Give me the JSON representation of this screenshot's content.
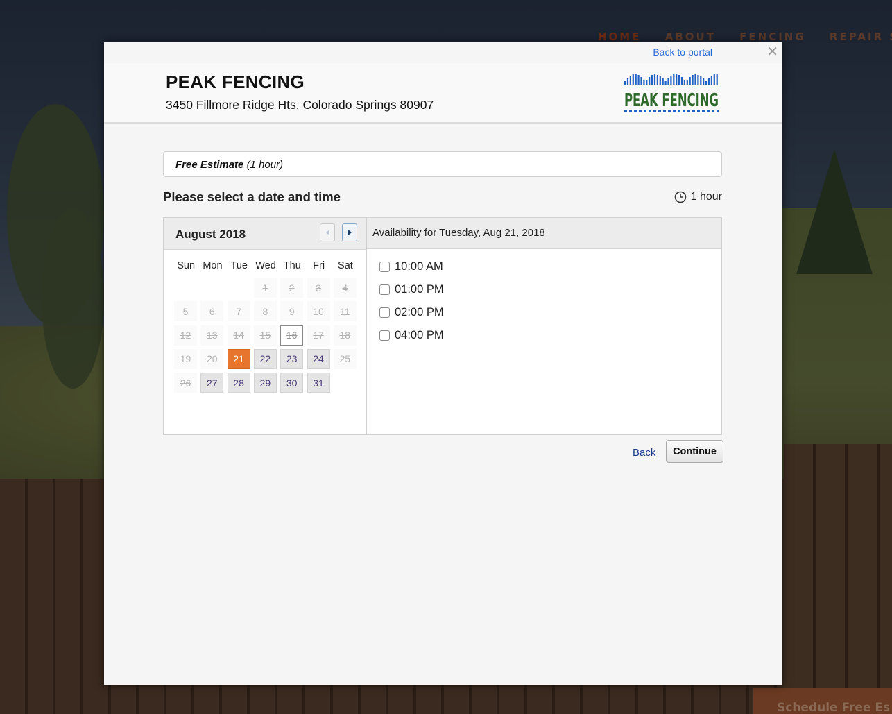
{
  "background": {
    "nav": [
      "HOME",
      "ABOUT",
      "FENCING",
      "REPAIR SERVIC"
    ],
    "cta_label": "Schedule Free Es"
  },
  "modal": {
    "back_to_portal": "Back to portal",
    "close_icon": "close-icon"
  },
  "business": {
    "name": "PEAK FENCING",
    "address": "3450 Fillmore Ridge Hts. Colorado Springs 80907",
    "logo_text": "PEAK FENCING",
    "colors": {
      "logo_blue": "#1e63c4",
      "logo_green": "#2e6b2a"
    }
  },
  "service": {
    "name": "Free Estimate",
    "duration": "(1 hour)"
  },
  "heading": "Please select a date and time",
  "duration_label": "1 hour",
  "calendar": {
    "month": "August 2018",
    "weekdays": [
      "Sun",
      "Mon",
      "Tue",
      "Wed",
      "Thu",
      "Fri",
      "Sat"
    ],
    "first_weekday_index": 3,
    "days_in_month": 31,
    "past_days": [
      1,
      2,
      3,
      4,
      5,
      6,
      7,
      8,
      9,
      10,
      11,
      12,
      13,
      14,
      15,
      16,
      17,
      18,
      19,
      20,
      25,
      26
    ],
    "today": 16,
    "selected": 21,
    "available": [
      22,
      23,
      24,
      27,
      28,
      29,
      30,
      31
    ],
    "colors": {
      "selected": "#e8752e"
    }
  },
  "availability": {
    "title": "Availability for Tuesday, Aug 21, 2018",
    "slots": [
      "10:00 AM",
      "01:00 PM",
      "02:00 PM",
      "04:00 PM"
    ]
  },
  "actions": {
    "back": "Back",
    "continue": "Continue"
  }
}
